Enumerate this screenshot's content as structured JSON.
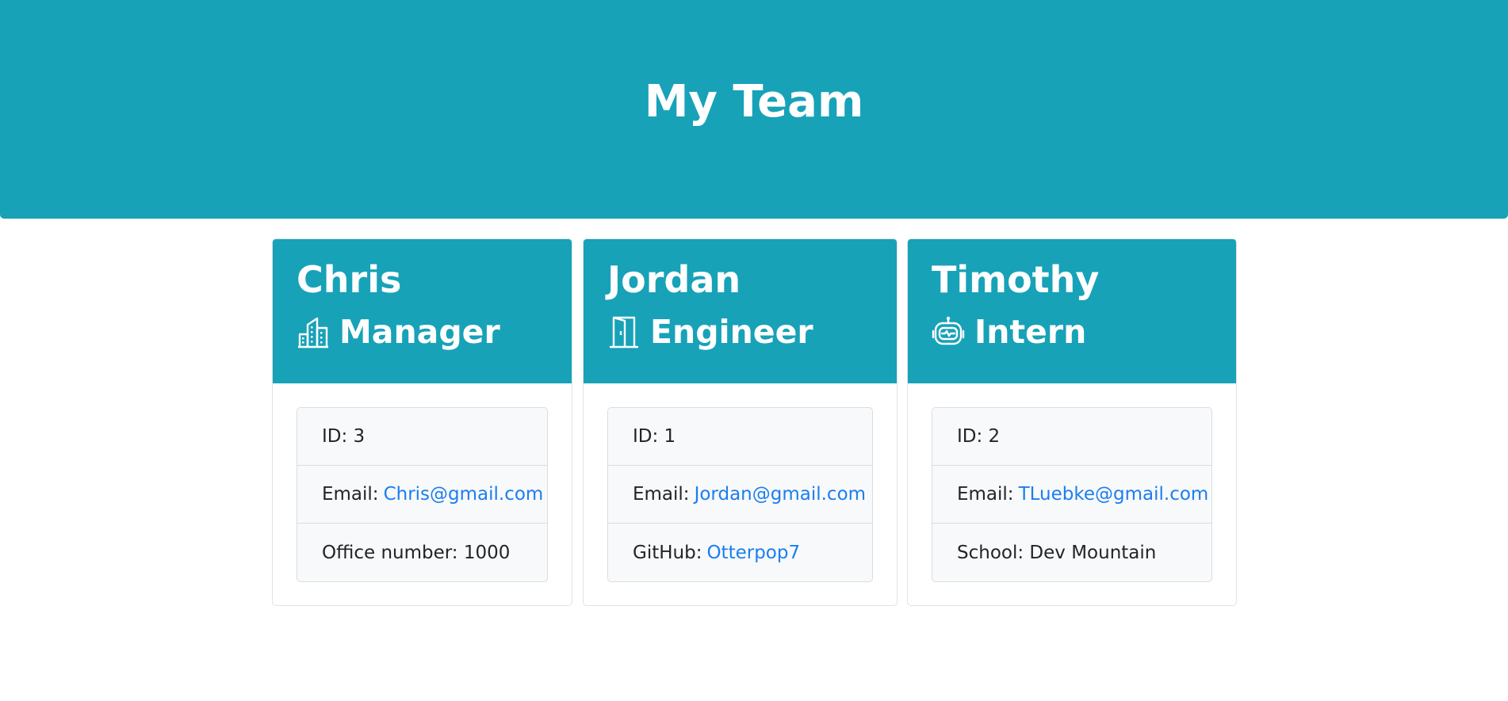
{
  "header": {
    "title": "My Team"
  },
  "colors": {
    "accent": "#17a2b8",
    "link": "#1b7ef0",
    "list_bg": "#f8f9fa"
  },
  "cards": [
    {
      "name": "Chris",
      "role": "Manager",
      "role_icon": "building-icon",
      "id_text": "ID: 3",
      "email_label": "Email:",
      "email": "Chris@gmail.com",
      "extra_label": "Office number: 1000",
      "extra_link": ""
    },
    {
      "name": "Jordan",
      "role": "Engineer",
      "role_icon": "door-icon",
      "id_text": "ID: 1",
      "email_label": "Email:",
      "email": "Jordan@gmail.com",
      "extra_label": "GitHub:",
      "extra_link": "Otterpop7"
    },
    {
      "name": "Timothy",
      "role": "Intern",
      "role_icon": "robot-icon",
      "id_text": "ID: 2",
      "email_label": "Email:",
      "email": "TLuebke@gmail.com",
      "extra_label": "School: Dev Mountain",
      "extra_link": ""
    }
  ]
}
